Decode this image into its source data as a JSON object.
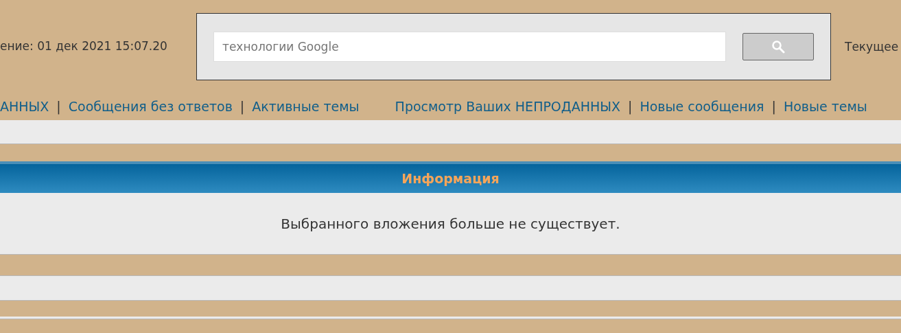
{
  "header": {
    "last_visit": "ение: 01 дек 2021 15:07.20",
    "search": {
      "placeholder": "технологии Google"
    },
    "current_time": "Текущее"
  },
  "nav": {
    "left": [
      {
        "kind": "link",
        "label": "АННЫХ"
      },
      {
        "kind": "separator",
        "label": "|"
      },
      {
        "kind": "link",
        "label": "Сообщения без ответов"
      },
      {
        "kind": "separator",
        "label": "|"
      },
      {
        "kind": "link",
        "label": "Активные темы"
      }
    ],
    "right": [
      {
        "kind": "link",
        "label": "Просмотр Ваших НЕПРОДАННЫХ"
      },
      {
        "kind": "separator",
        "label": "|"
      },
      {
        "kind": "link",
        "label": "Новые сообщения"
      },
      {
        "kind": "separator",
        "label": "|"
      },
      {
        "kind": "link",
        "label": "Новые темы"
      }
    ]
  },
  "info": {
    "title": "Информация",
    "message": "Выбранного вложения больше не существует."
  }
}
